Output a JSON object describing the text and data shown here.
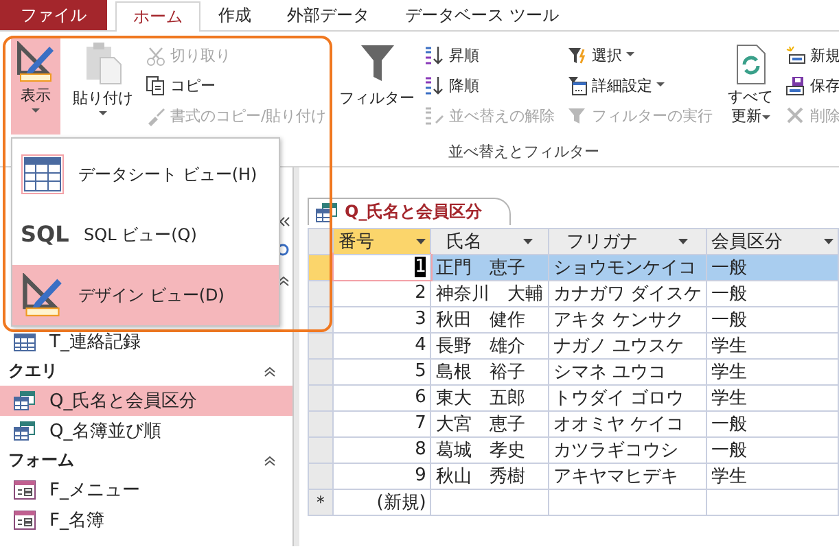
{
  "tabs": [
    {
      "label": "ファイル",
      "kind": "file",
      "selected": false
    },
    {
      "label": "ホーム",
      "kind": "tab",
      "selected": true
    },
    {
      "label": "作成",
      "kind": "tab",
      "selected": false
    },
    {
      "label": "外部データ",
      "kind": "tab",
      "selected": false
    },
    {
      "label": "データベース ツール",
      "kind": "tab",
      "selected": false
    }
  ],
  "ribbon": {
    "view_button": {
      "label": "表示",
      "pressed": true
    },
    "paste_button": {
      "label": "貼り付け"
    },
    "clipboard_buttons": [
      {
        "label": "切り取り",
        "disabled": true
      },
      {
        "label": "コピー",
        "disabled": false
      },
      {
        "label": "書式のコピー/貼り付け",
        "disabled": true
      }
    ],
    "filter_button": {
      "label": "フィルター"
    },
    "sort_buttons": [
      {
        "label": "昇順",
        "disabled": false
      },
      {
        "label": "降順",
        "disabled": false
      },
      {
        "label": "並べ替えの解除",
        "disabled": true
      }
    ],
    "filter_buttons": [
      {
        "label": "選択",
        "dropdown": true,
        "disabled": false
      },
      {
        "label": "詳細設定",
        "dropdown": true,
        "disabled": false
      },
      {
        "label": "フィルターの実行",
        "dropdown": false,
        "disabled": true
      }
    ],
    "sort_filter_group": "並べ替えとフィルター",
    "refresh_button": {
      "label_lines": [
        "すべて",
        "更新"
      ]
    },
    "record_buttons": [
      {
        "label": "新規",
        "disabled": false
      },
      {
        "label": "保存",
        "disabled": false
      },
      {
        "label": "削除",
        "disabled": true
      }
    ]
  },
  "view_menu": [
    {
      "label": "データシート ビュー(H)",
      "kind": "datasheet",
      "selected": false
    },
    {
      "label": "SQL ビュー(Q)",
      "kind": "sql",
      "icon_text": "SQL",
      "selected": false
    },
    {
      "label": "デザイン ビュー(D)",
      "kind": "design",
      "selected": true
    }
  ],
  "nav_pane": {
    "items_top": [
      {
        "label": "T_連絡記録",
        "kind": "table",
        "selected": false
      }
    ],
    "groups": [
      {
        "label": "クエリ",
        "items": [
          {
            "label": "Q_氏名と会員区分",
            "kind": "query",
            "selected": true
          },
          {
            "label": "Q_名簿並び順",
            "kind": "query",
            "selected": false
          }
        ]
      },
      {
        "label": "フォーム",
        "items": [
          {
            "label": "F_メニュー",
            "kind": "form",
            "selected": false
          },
          {
            "label": "F_名簿",
            "kind": "form",
            "selected": false
          }
        ]
      }
    ]
  },
  "document": {
    "tab": "Q_氏名と会員区分",
    "columns": [
      {
        "label": "番号",
        "selected": true
      },
      {
        "label": "氏名",
        "selected": false
      },
      {
        "label": "フリガナ",
        "selected": false
      },
      {
        "label": "会員区分",
        "selected": false
      }
    ],
    "rows": [
      {
        "cells": [
          "1",
          "正門　恵子",
          "ショウモンケイコ",
          "一般"
        ],
        "selected": true
      },
      {
        "cells": [
          "2",
          "神奈川　大輔",
          "カナガワ ダイスケ",
          "一般"
        ],
        "selected": false
      },
      {
        "cells": [
          "3",
          "秋田　健作",
          "アキタ ケンサク",
          "一般"
        ],
        "selected": false
      },
      {
        "cells": [
          "4",
          "長野　雄介",
          "ナガノ ユウスケ",
          "学生"
        ],
        "selected": false
      },
      {
        "cells": [
          "5",
          "島根　裕子",
          "シマネ ユウコ",
          "学生"
        ],
        "selected": false
      },
      {
        "cells": [
          "6",
          "東大　五郎",
          "トウダイ ゴロウ",
          "学生"
        ],
        "selected": false
      },
      {
        "cells": [
          "7",
          "大宮　恵子",
          "オオミヤ ケイコ",
          "一般"
        ],
        "selected": false
      },
      {
        "cells": [
          "8",
          "葛城　孝史",
          "カツラギコウシ",
          "一般"
        ],
        "selected": false
      },
      {
        "cells": [
          "9",
          "秋山　秀樹",
          "アキヤマヒデキ",
          "学生"
        ],
        "selected": false
      }
    ],
    "new_row": {
      "marker": "＊",
      "label": "(新規)"
    }
  }
}
